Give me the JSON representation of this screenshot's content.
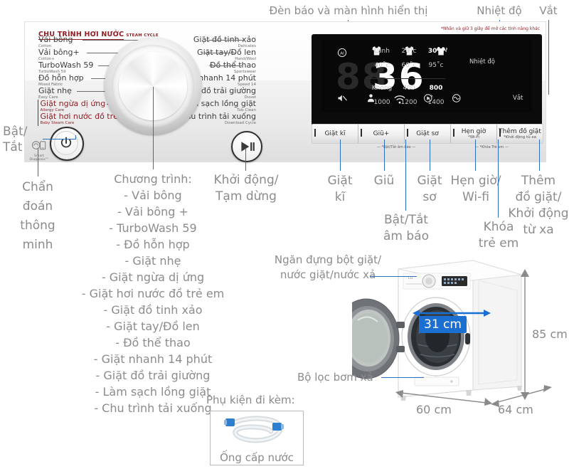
{
  "annotations": {
    "display_top": "Đèn báo và màn hình hiển thị",
    "temp_top": "Nhiệt độ",
    "spin_top": "Vắt",
    "power": "Bật/\nTắt",
    "smart_diagnosis": "Chẩn\nđoán\nthông\nminh",
    "start_pause": "Khởi động/\nTạm dừng",
    "programs": "Chương trình:\n- Vải bông\n- Vải bông +\n- TurboWash 59\n- Đồ hỗn hợp\n- Giặt nhẹ\n- Giặt ngừa dị ứng\n- Giặt hơi nước đồ trẻ em\n- Giặt đồ tinh xảo\n- Giặt tay/Đồ len\n- Đồ thể thao\n- Giặt nhanh 14 phút\n- Giặt đồ trải giường\n- Làm sạch lồng giặt\n- Chu trình tải xuống",
    "btn_giat_ki": "Giặt\nkĩ",
    "btn_giu": "Giũ",
    "btn_giat_so": "Giặt\nsơ",
    "btn_sound": "Bật/Tắt\nâm báo",
    "btn_timer": "Hẹn giờ/\nWi-fi",
    "btn_childlock": "Khóa\ntrẻ em",
    "btn_addlaundry": "Thêm\nđồ giặt/\nKhởi động\ntừ xa",
    "detergent_drawer": "Ngăn đựng bột giặt/\nnước giặt/nước xả",
    "pump_filter": "Bộ lọc bơm xả",
    "accessories_title": "Phụ kiện đi kèm:",
    "accessory_item": "Ống cấp nước"
  },
  "panel": {
    "cycle_header_vn": "CHU TRÌNH HƠI NƯỚC",
    "cycle_header_en": "STEAM CYCLE",
    "note_red": "*Nhấn và giữ 3 giây để mở các tính năng khác",
    "left_cycles": [
      {
        "vn": "Vải bông",
        "en": "Cotton",
        "red": false
      },
      {
        "vn": "Vải bông+",
        "en": "Cotton+",
        "red": false
      },
      {
        "vn": "TurboWash 59",
        "en": "TurboWash 59",
        "red": false
      },
      {
        "vn": "Đồ hỗn hợp",
        "en": "Mixed Fabric",
        "red": false
      },
      {
        "vn": "Giặt nhẹ",
        "en": "Easy Care",
        "red": false
      },
      {
        "vn": "Giặt ngừa dị ứng",
        "en": "Allergy Care",
        "red": true
      },
      {
        "vn": "Giặt hơi nước đồ trẻ em",
        "en": "Baby Steam Care",
        "red": true
      }
    ],
    "right_cycles": [
      {
        "vn": "Giặt đồ tinh xảo",
        "en": "Delicates"
      },
      {
        "vn": "Giặt tay/Đồ len",
        "en": "Hand/Wool"
      },
      {
        "vn": "Đồ thể thao",
        "en": "Sportswear"
      },
      {
        "vn": "Giặt nhanh 14 phút",
        "en": "Speed 14"
      },
      {
        "vn": "Giặt đồ trải giường",
        "en": "Duvet"
      },
      {
        "vn": "Làm sạch lồng giặt",
        "en": "Tub Clean"
      },
      {
        "vn": "Chu trình tải xuống",
        "en": "Download Cycle"
      }
    ],
    "smart_diagnosis_label": "Smart\nDiagnosis™",
    "buttons": [
      {
        "title": "Giặt kĩ",
        "sub": ""
      },
      {
        "title": "Giũ+",
        "sub": ""
      },
      {
        "title": "Giặt sơ",
        "sub": ""
      },
      {
        "title": "Hẹn giờ",
        "sub": "*Wi-Fi"
      },
      {
        "title": "Thêm đồ giặt",
        "sub": "*Khởi động từ xa"
      }
    ],
    "strip_sub_left": "— *Bật/Tắt âm báo —",
    "strip_sub_right": "— *Khóa Trẻ em —"
  },
  "display": {
    "time_digits": "36",
    "dim_digits": "88",
    "top_icons": [
      "ai-icon",
      "shirt-icon",
      "shirt-icon",
      "shirt-steam-icon"
    ],
    "bottom_icons": [
      "mute-icon",
      "child-lock-icon",
      "wifi-icon",
      "remote-start-icon",
      "tub-clean-icon"
    ],
    "temperature": {
      "label": "Nhiệt độ",
      "options": [
        "Lạnh",
        "20˚c",
        "30˚c",
        "40˚c",
        "60˚c",
        "95˚c"
      ],
      "selected": "30˚c"
    },
    "spin": {
      "label": "Vắt",
      "options": [
        "Không",
        "400",
        "800",
        "1000",
        "1200",
        "1400"
      ],
      "selected": "800"
    }
  },
  "machine": {
    "width": "60 cm",
    "depth": "64 cm",
    "height": "85 cm",
    "door_opening": "31 cm"
  },
  "colors": {
    "accent": "#2d6fbe",
    "badge": "#1b6fd0",
    "annotation_text": "#8a8a8a",
    "steam_red": "#8e2026"
  }
}
